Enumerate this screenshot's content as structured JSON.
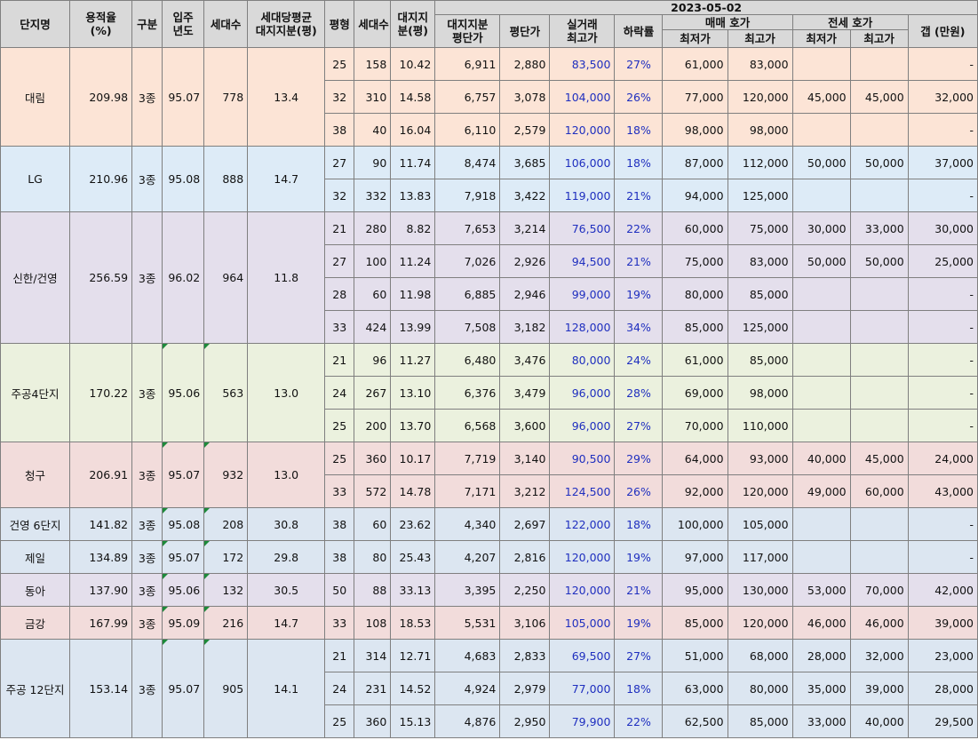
{
  "headers": {
    "name": "단지명",
    "far": "용적율\n(%)",
    "zone": "구분",
    "year": "입주\n년도",
    "units": "세대수",
    "avg_land": "세대당평균\n대지지분(평)",
    "type": "평형",
    "type_units": "세대수",
    "land": "대지지\n분(평)",
    "land_price": "대지지분\n평단가",
    "py_price": "평단가",
    "actual": "실거래\n최고가",
    "drop": "하락률",
    "date": "2023-05-02",
    "sale": "매매 호가",
    "jeonse": "전세 호가",
    "min": "최저가",
    "max": "최고가",
    "gap": "갭 (만원)"
  },
  "groups": [
    {
      "name": "대림",
      "far": "209.98",
      "zone": "3종",
      "year": "95.07",
      "units": "778",
      "avg_land": "13.4",
      "tri": false,
      "rows": [
        {
          "type": "25",
          "cnt": "158",
          "land": "10.42",
          "lp": "6,911",
          "pp": "2,880",
          "act": "83,500",
          "drop": "27%",
          "smin": "61,000",
          "smax": "83,000",
          "jmin": "",
          "jmax": "",
          "gap": "-"
        },
        {
          "type": "32",
          "cnt": "310",
          "land": "14.58",
          "lp": "6,757",
          "pp": "3,078",
          "act": "104,000",
          "drop": "26%",
          "smin": "77,000",
          "smax": "120,000",
          "jmin": "45,000",
          "jmax": "45,000",
          "gap": "32,000"
        },
        {
          "type": "38",
          "cnt": "40",
          "land": "16.04",
          "lp": "6,110",
          "pp": "2,579",
          "act": "120,000",
          "drop": "18%",
          "smin": "98,000",
          "smax": "98,000",
          "jmin": "",
          "jmax": "",
          "gap": "-"
        }
      ]
    },
    {
      "name": "LG",
      "far": "210.96",
      "zone": "3종",
      "year": "95.08",
      "units": "888",
      "avg_land": "14.7",
      "tri": false,
      "rows": [
        {
          "type": "27",
          "cnt": "90",
          "land": "11.74",
          "lp": "8,474",
          "pp": "3,685",
          "act": "106,000",
          "drop": "18%",
          "smin": "87,000",
          "smax": "112,000",
          "jmin": "50,000",
          "jmax": "50,000",
          "gap": "37,000"
        },
        {
          "type": "32",
          "cnt": "332",
          "land": "13.83",
          "lp": "7,918",
          "pp": "3,422",
          "act": "119,000",
          "drop": "21%",
          "smin": "94,000",
          "smax": "125,000",
          "jmin": "",
          "jmax": "",
          "gap": "-"
        }
      ]
    },
    {
      "name": "신한/건영",
      "far": "256.59",
      "zone": "3종",
      "year": "96.02",
      "units": "964",
      "avg_land": "11.8",
      "tri": false,
      "rows": [
        {
          "type": "21",
          "cnt": "280",
          "land": "8.82",
          "lp": "7,653",
          "pp": "3,214",
          "act": "76,500",
          "drop": "22%",
          "smin": "60,000",
          "smax": "75,000",
          "jmin": "30,000",
          "jmax": "33,000",
          "gap": "30,000"
        },
        {
          "type": "27",
          "cnt": "100",
          "land": "11.24",
          "lp": "7,026",
          "pp": "2,926",
          "act": "94,500",
          "drop": "21%",
          "smin": "75,000",
          "smax": "83,000",
          "jmin": "50,000",
          "jmax": "50,000",
          "gap": "25,000"
        },
        {
          "type": "28",
          "cnt": "60",
          "land": "11.98",
          "lp": "6,885",
          "pp": "2,946",
          "act": "99,000",
          "drop": "19%",
          "smin": "80,000",
          "smax": "85,000",
          "jmin": "",
          "jmax": "",
          "gap": "-"
        },
        {
          "type": "33",
          "cnt": "424",
          "land": "13.99",
          "lp": "7,508",
          "pp": "3,182",
          "act": "128,000",
          "drop": "34%",
          "smin": "85,000",
          "smax": "125,000",
          "jmin": "",
          "jmax": "",
          "gap": "-"
        }
      ]
    },
    {
      "name": "주공4단지",
      "far": "170.22",
      "zone": "3종",
      "year": "95.06",
      "units": "563",
      "avg_land": "13.0",
      "tri": true,
      "rows": [
        {
          "type": "21",
          "cnt": "96",
          "land": "11.27",
          "lp": "6,480",
          "pp": "3,476",
          "act": "80,000",
          "drop": "24%",
          "smin": "61,000",
          "smax": "85,000",
          "jmin": "",
          "jmax": "",
          "gap": "-"
        },
        {
          "type": "24",
          "cnt": "267",
          "land": "13.10",
          "lp": "6,376",
          "pp": "3,479",
          "act": "96,000",
          "drop": "28%",
          "smin": "69,000",
          "smax": "98,000",
          "jmin": "",
          "jmax": "",
          "gap": "-"
        },
        {
          "type": "25",
          "cnt": "200",
          "land": "13.70",
          "lp": "6,568",
          "pp": "3,600",
          "act": "96,000",
          "drop": "27%",
          "smin": "70,000",
          "smax": "110,000",
          "jmin": "",
          "jmax": "",
          "gap": "-"
        }
      ]
    },
    {
      "name": "청구",
      "far": "206.91",
      "zone": "3종",
      "year": "95.07",
      "units": "932",
      "avg_land": "13.0",
      "tri": true,
      "rows": [
        {
          "type": "25",
          "cnt": "360",
          "land": "10.17",
          "lp": "7,719",
          "pp": "3,140",
          "act": "90,500",
          "drop": "29%",
          "smin": "64,000",
          "smax": "93,000",
          "jmin": "40,000",
          "jmax": "45,000",
          "gap": "24,000"
        },
        {
          "type": "33",
          "cnt": "572",
          "land": "14.78",
          "lp": "7,171",
          "pp": "3,212",
          "act": "124,500",
          "drop": "26%",
          "smin": "92,000",
          "smax": "120,000",
          "jmin": "49,000",
          "jmax": "60,000",
          "gap": "43,000"
        }
      ]
    },
    {
      "name": "건영 6단지",
      "far": "141.82",
      "zone": "3종",
      "year": "95.08",
      "units": "208",
      "avg_land": "30.8",
      "tri": true,
      "rows": [
        {
          "type": "38",
          "cnt": "60",
          "land": "23.62",
          "lp": "4,340",
          "pp": "2,697",
          "act": "122,000",
          "drop": "18%",
          "smin": "100,000",
          "smax": "105,000",
          "jmin": "",
          "jmax": "",
          "gap": "-"
        }
      ]
    },
    {
      "name": "제일",
      "far": "134.89",
      "zone": "3종",
      "year": "95.07",
      "units": "172",
      "avg_land": "29.8",
      "tri": true,
      "rows": [
        {
          "type": "38",
          "cnt": "80",
          "land": "25.43",
          "lp": "4,207",
          "pp": "2,816",
          "act": "120,000",
          "drop": "19%",
          "smin": "97,000",
          "smax": "117,000",
          "jmin": "",
          "jmax": "",
          "gap": "-"
        }
      ]
    },
    {
      "name": "동아",
      "far": "137.90",
      "zone": "3종",
      "year": "95.06",
      "units": "132",
      "avg_land": "30.5",
      "tri": true,
      "rows": [
        {
          "type": "50",
          "cnt": "88",
          "land": "33.13",
          "lp": "3,395",
          "pp": "2,250",
          "act": "120,000",
          "drop": "21%",
          "smin": "95,000",
          "smax": "130,000",
          "jmin": "53,000",
          "jmax": "70,000",
          "gap": "42,000"
        }
      ]
    },
    {
      "name": "금강",
      "far": "167.99",
      "zone": "3종",
      "year": "95.09",
      "units": "216",
      "avg_land": "14.7",
      "tri": true,
      "rows": [
        {
          "type": "33",
          "cnt": "108",
          "land": "18.53",
          "lp": "5,531",
          "pp": "3,106",
          "act": "105,000",
          "drop": "19%",
          "smin": "85,000",
          "smax": "120,000",
          "jmin": "46,000",
          "jmax": "46,000",
          "gap": "39,000"
        }
      ]
    },
    {
      "name": "주공 12단지",
      "far": "153.14",
      "zone": "3종",
      "year": "95.07",
      "units": "905",
      "avg_land": "14.1",
      "tri": true,
      "rows": [
        {
          "type": "21",
          "cnt": "314",
          "land": "12.71",
          "lp": "4,683",
          "pp": "2,833",
          "act": "69,500",
          "drop": "27%",
          "smin": "51,000",
          "smax": "68,000",
          "jmin": "28,000",
          "jmax": "32,000",
          "gap": "23,000"
        },
        {
          "type": "24",
          "cnt": "231",
          "land": "14.52",
          "lp": "4,924",
          "pp": "2,979",
          "act": "77,000",
          "drop": "18%",
          "smin": "63,000",
          "smax": "80,000",
          "jmin": "35,000",
          "jmax": "39,000",
          "gap": "28,000"
        },
        {
          "type": "25",
          "cnt": "360",
          "land": "15.13",
          "lp": "4,876",
          "pp": "2,950",
          "act": "79,900",
          "drop": "22%",
          "smin": "62,500",
          "smax": "85,000",
          "jmin": "33,000",
          "jmax": "40,000",
          "gap": "29,500"
        }
      ]
    }
  ]
}
